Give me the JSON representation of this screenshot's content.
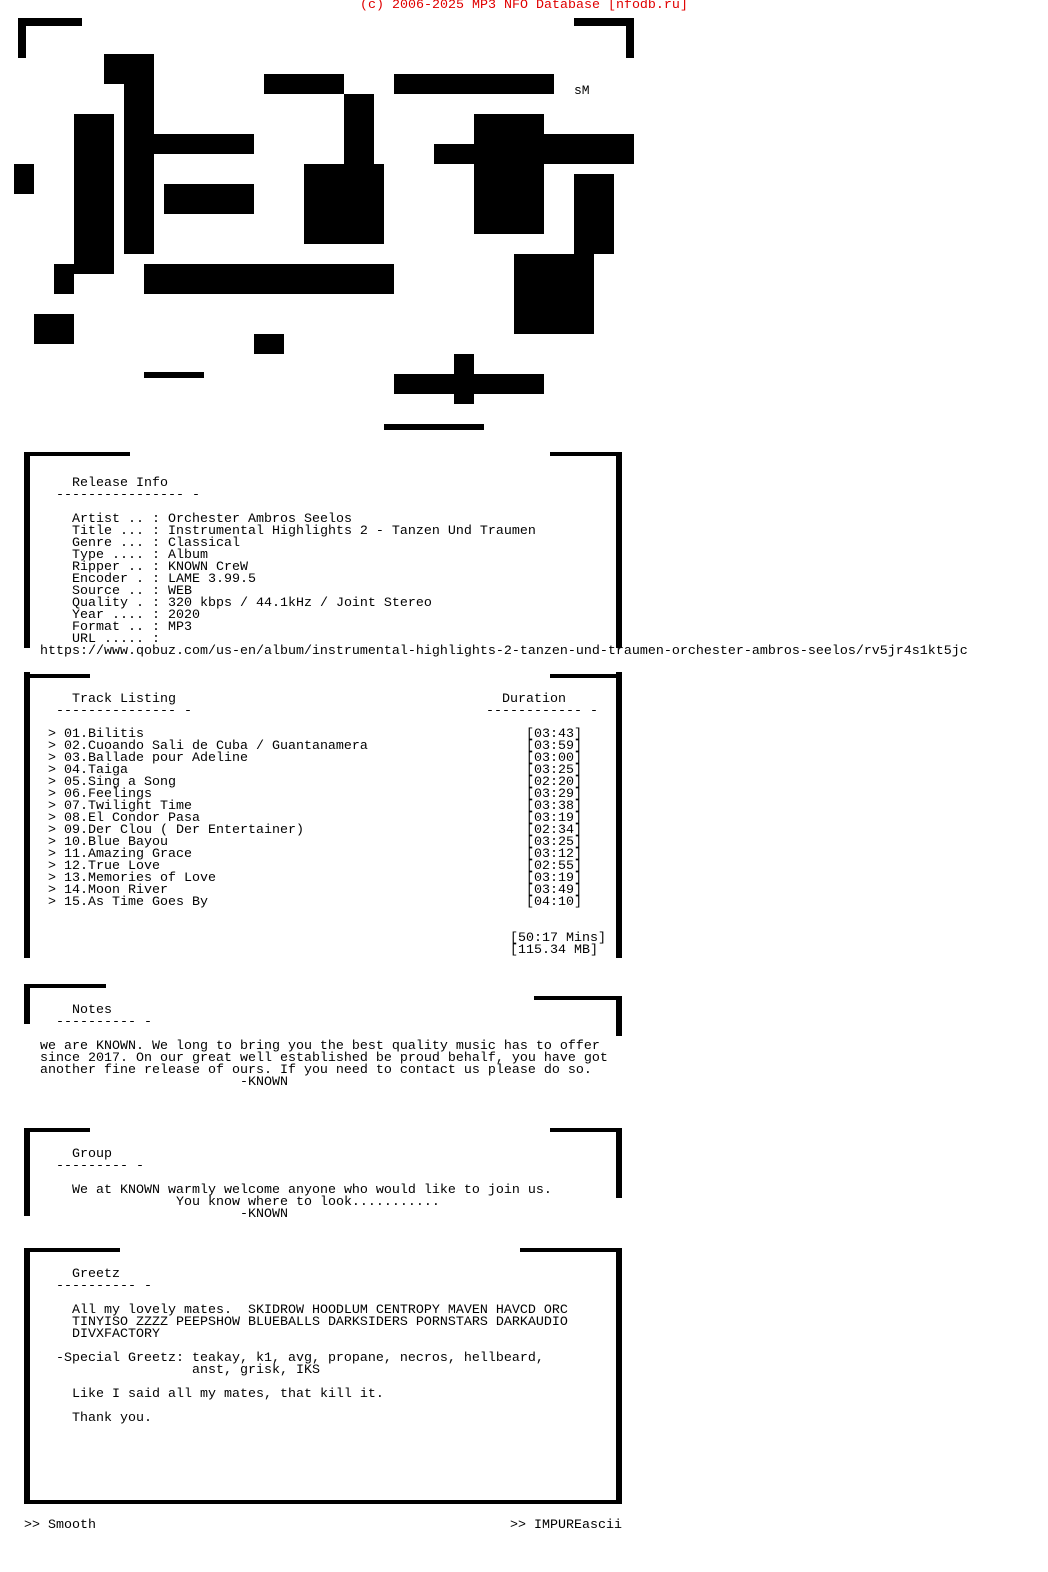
{
  "credit": "(c) 2006-2025 MP3 NFO Database [nfodb.ru]",
  "logo_tag": "sM",
  "release": {
    "header": "Release Info",
    "underline": "---------------- -",
    "lines": [
      "Artist .. : Orchester Ambros Seelos",
      "Title ... : Instrumental Highlights 2 - Tanzen Und Traumen",
      "Genre ... : Classical",
      "Type .... : Album",
      "Ripper .. : KNOWN CreW",
      "Encoder . : LAME 3.99.5",
      "Source .. : WEB",
      "Quality . : 320 kbps / 44.1kHz / Joint Stereo",
      "Year .... : 2020",
      "Format .. : MP3",
      "URL ..... :"
    ],
    "url": "https://www.qobuz.com/us-en/album/instrumental-highlights-2-tanzen-und-traumen-orchester-ambros-seelos/rv5jr4s1kt5jc"
  },
  "tracks": {
    "header": "Track Listing",
    "underline": "--------------- -",
    "duration_header": "Duration",
    "duration_underline": "------------ -",
    "items": [
      [
        "> 01.Bilitis",
        "[03:43]"
      ],
      [
        "> 02.Cuoando Sali de Cuba / Guantanamera",
        "[03:59]"
      ],
      [
        "> 03.Ballade pour Adeline",
        "[03:00]"
      ],
      [
        "> 04.Taiga",
        "[03:25]"
      ],
      [
        "> 05.Sing a Song",
        "[02:20]"
      ],
      [
        "> 06.Feelings",
        "[03:29]"
      ],
      [
        "> 07.Twilight Time",
        "[03:38]"
      ],
      [
        "> 08.El Condor Pasa",
        "[03:19]"
      ],
      [
        "> 09.Der Clou ( Der Entertainer)",
        "[02:34]"
      ],
      [
        "> 10.Blue Bayou",
        "[03:25]"
      ],
      [
        "> 11.Amazing Grace",
        "[03:12]"
      ],
      [
        "> 12.True Love",
        "[02:55]"
      ],
      [
        "> 13.Memories of Love",
        "[03:19]"
      ],
      [
        "> 14.Moon River",
        "[03:49]"
      ],
      [
        "> 15.As Time Goes By",
        "[04:10]"
      ]
    ],
    "total_time": "[50:17 Mins]",
    "total_size": "[115.34 MB]"
  },
  "notes": {
    "header": "Notes",
    "underline": "---------- -",
    "lines": [
      "we are KNOWN. We long to bring you the best quality music has to offer",
      "since 2017. On our great well established be proud behalf, you have got",
      "another fine release of ours. If you need to contact us please do so.",
      "                         -KNOWN"
    ]
  },
  "group": {
    "header": "Group",
    "underline": "--------- -",
    "lines": [
      "We at KNOWN warmly welcome anyone who would like to join us.",
      "             You know where to look...........",
      "                     -KNOWN"
    ]
  },
  "greetz": {
    "header": "Greetz",
    "underline": "---------- -",
    "lines": [
      "  All my lovely mates.  SKIDROW HOODLUM CENTROPY MAVEN HAVCD ORC",
      "  TINYISO ZZZZ PEEPSHOW BLUEBALLS DARKSIDERS PORNSTARS DARKAUDIO",
      "  DIVXFACTORY",
      "",
      "-Special Greetz: teakay, k1, avg, propane, necros, hellbeard,",
      "                 anst, grisk, IKS",
      "",
      "  Like I said all my mates, that kill it.",
      "",
      "  Thank you."
    ]
  },
  "footer": {
    "left": ">> Smooth",
    "right": ">> IMPUREascii"
  }
}
